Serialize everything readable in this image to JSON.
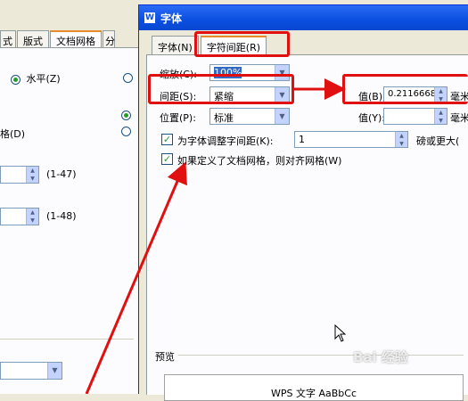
{
  "background_dialog": {
    "tabs": [
      {
        "label": "式"
      },
      {
        "label": "版式"
      },
      {
        "label": "文档网格",
        "active": true
      },
      {
        "label": "分"
      }
    ],
    "radio_horizontal": "水平(Z)",
    "grid_label": "格(D)",
    "spin1_range": "(1-47)",
    "spin2_range": "(1-48)"
  },
  "dialog": {
    "title": "字体",
    "tabs": [
      {
        "label": "字体(N)"
      },
      {
        "label": "字符间距(R)",
        "active": true
      }
    ],
    "scale_label": "缩放(C):",
    "scale_value": "100%",
    "spacing_label": "间距(S):",
    "spacing_value": "紧缩",
    "value_label": "值(B):",
    "value_value": "0.2116668",
    "value_unit": "毫米",
    "position_label": "位置(P):",
    "position_value": "标准",
    "position_value_label": "值(Y):",
    "position_unit": "毫米",
    "kerning_label": "为字体调整字间距(K):",
    "kerning_value": "1",
    "kerning_suffix": "磅或更大(",
    "grid_align_label": "如果定义了文档网格，则对齐网格(W)",
    "preview_label": "预览",
    "preview_text": "WPS 文字 AaBbCc"
  },
  "watermark": "Bai  经验",
  "colors": {
    "annotation": "#e01010",
    "titlebar": "#0a4ee0",
    "tab_highlight": "#e68b2c"
  }
}
